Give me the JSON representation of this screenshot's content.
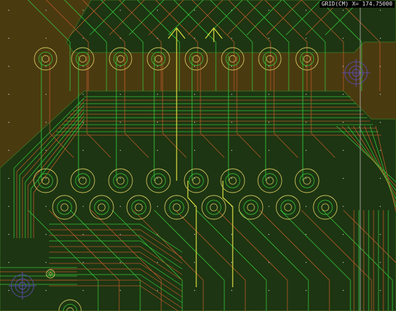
{
  "status": {
    "grid_readout": "GRID(CM) X= 174.75000"
  },
  "colors": {
    "board_copper": "#4a3a10",
    "ground_plane": "#1d3512",
    "plane_edge": "#3c6a20",
    "trace_green": "#34c53a",
    "trace_red": "#b85a2a",
    "trace_yellow": "#e0e040",
    "pad_ring": "#d0c560",
    "target_marker": "#5a4aa8",
    "grid_dot": "#c8c8c8",
    "vertical_guide": "#bcbcbc"
  },
  "legend": {
    "canvas_icon": "pcb-layout-canvas"
  }
}
